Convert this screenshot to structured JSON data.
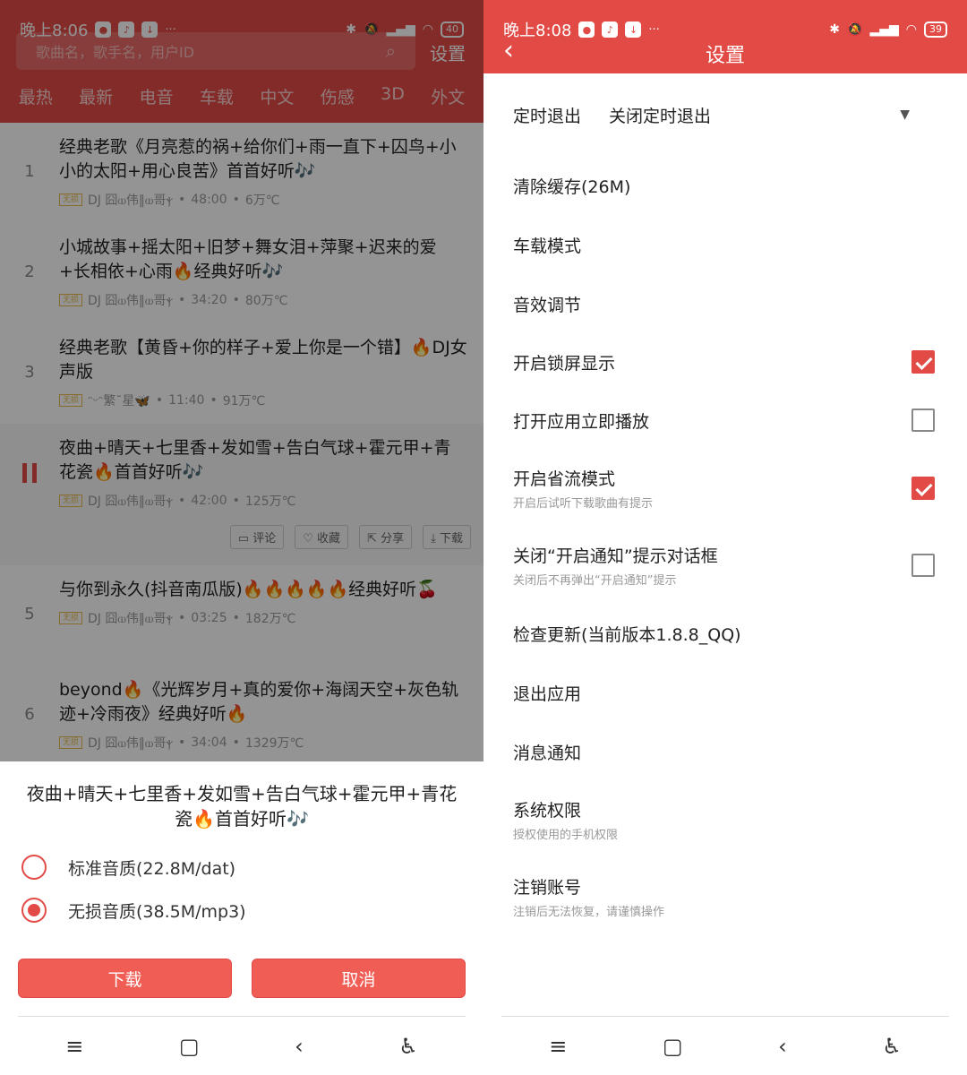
{
  "left": {
    "status": {
      "time": "晚上8:06",
      "battery": "40"
    },
    "search": {
      "placeholder": "歌曲名，歌手名，用户ID"
    },
    "settings_link": "设置",
    "tabs": [
      "最热",
      "最新",
      "电音",
      "车载",
      "中文",
      "伤感",
      "3D",
      "外文"
    ],
    "songs": [
      {
        "num": "1",
        "title": "经典老歌《月亮惹的祸+给你们+雨一直下+囚鸟+小小的太阳+用心良苦》首首好听🎶",
        "tag": "无损",
        "author": "DJ 囧ⲱ伟‖ⲱ哥ⲯ",
        "duration": "48:00",
        "plays": "6万℃"
      },
      {
        "num": "2",
        "title": "小城故事+摇太阳+旧梦+舞女泪+萍聚+迟来的爱+长相依+心雨🔥经典好听🎶",
        "tag": "无损",
        "author": "DJ 囧ⲱ伟‖ⲱ哥ⲯ",
        "duration": "34:20",
        "plays": "80万℃"
      },
      {
        "num": "3",
        "title": "经典老歌【黄昏+你的样子+爱上你是一个错】🔥DJ女声版",
        "tag": "无损",
        "author": "ᵔᵕᵔ繁˘星🦋",
        "duration": "11:40",
        "plays": "91万℃"
      },
      {
        "num": "",
        "title": "夜曲+晴天+七里香+发如雪+告白气球+霍元甲+青花瓷🔥首首好听🎶",
        "tag": "无损",
        "author": "DJ 囧ⲱ伟‖ⲱ哥ⲯ",
        "duration": "42:00",
        "plays": "125万℃"
      },
      {
        "num": "5",
        "title": "与你到永久(抖音南瓜版)🔥🔥🔥🔥🔥经典好听🍒",
        "tag": "无损",
        "author": "DJ 囧ⲱ伟‖ⲱ哥ⲯ",
        "duration": "03:25",
        "plays": "182万℃"
      },
      {
        "num": "6",
        "title": "beyond🔥《光辉岁月+真的爱你+海阔天空+灰色轨迹+冷雨夜》经典好听🔥",
        "tag": "无损",
        "author": "DJ 囧ⲱ伟‖ⲱ哥ⲯ",
        "duration": "34:04",
        "plays": "1329万℃"
      }
    ],
    "actions": {
      "comment": "评论",
      "favorite": "收藏",
      "share": "分享",
      "download": "下载"
    },
    "sheet": {
      "title": "夜曲+晴天+七里香+发如雪+告白气球+霍元甲+青花瓷🔥首首好听🎶",
      "option_standard": "标准音质(22.8M/dat)",
      "option_lossless": "无损音质(38.5M/mp3)",
      "download_btn": "下载",
      "cancel_btn": "取消"
    }
  },
  "right": {
    "status": {
      "time": "晚上8:08",
      "battery": "39"
    },
    "title": "设置",
    "rows": {
      "timer_label": "定时退出",
      "timer_value": "关闭定时退出",
      "clear_cache": "清除缓存(26M)",
      "car_mode": "车载模式",
      "sound": "音效调节",
      "lock_screen": "开启锁屏显示",
      "autoplay": "打开应用立即播放",
      "data_saver": "开启省流模式",
      "data_saver_sub": "开启后试听下载歌曲有提示",
      "close_notify": "关闭“开启通知”提示对话框",
      "close_notify_sub": "关闭后不再弹出“开启通知”提示",
      "check_update": "检查更新(当前版本1.8.8_QQ)",
      "exit": "退出应用",
      "notifications": "消息通知",
      "permissions": "系统权限",
      "permissions_sub": "授权使用的手机权限",
      "deregister": "注销账号",
      "deregister_sub": "注销后无法恢复，请谨慎操作"
    },
    "checkboxes": {
      "lock_screen": true,
      "autoplay": false,
      "data_saver": true,
      "close_notify": false
    }
  }
}
